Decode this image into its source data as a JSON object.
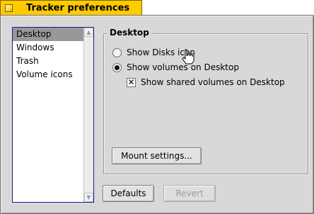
{
  "window": {
    "title": "Tracker preferences"
  },
  "sidebar": {
    "items": [
      {
        "label": "Desktop",
        "selected": true
      },
      {
        "label": "Windows",
        "selected": false
      },
      {
        "label": "Trash",
        "selected": false
      },
      {
        "label": "Volume icons",
        "selected": false
      }
    ]
  },
  "desktop_group": {
    "title": "Desktop",
    "show_disks_icon": {
      "label": "Show Disks icon",
      "checked": false
    },
    "show_volumes": {
      "label": "Show volumes on Desktop",
      "checked": true
    },
    "show_shared_volumes": {
      "label": "Show shared volumes on Desktop",
      "checked": true
    },
    "mount_settings_label": "Mount settings..."
  },
  "footer": {
    "defaults_label": "Defaults",
    "revert_label": "Revert",
    "revert_enabled": false
  },
  "colors": {
    "title_tab": "#ffcb00",
    "window_bg": "#d8d8d8",
    "list_border": "#0c1f8c",
    "list_selection": "#989898"
  },
  "icons": [
    "close-box-icon",
    "scroll-up-arrow-icon",
    "scroll-down-arrow-icon",
    "hand-cursor-icon"
  ]
}
